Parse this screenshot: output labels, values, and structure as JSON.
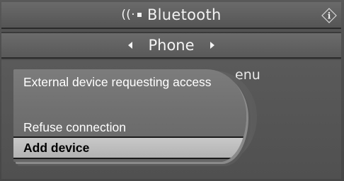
{
  "header": {
    "title": "Bluetooth",
    "bluetooth_icon": "bluetooth-signal-icon",
    "info_icon": "info-icon"
  },
  "tab": {
    "label": "Phone",
    "prev_icon": "arrow-left-icon",
    "next_icon": "arrow-right-icon"
  },
  "background": {
    "text_visible": "enu"
  },
  "dialog": {
    "title": "External device requesting access",
    "items": [
      {
        "label": "Refuse connection",
        "selected": false
      },
      {
        "label": "Add device",
        "selected": true
      }
    ]
  },
  "colors": {
    "selected_bg": "#bdbdbd",
    "screen_bg": "#505050"
  }
}
